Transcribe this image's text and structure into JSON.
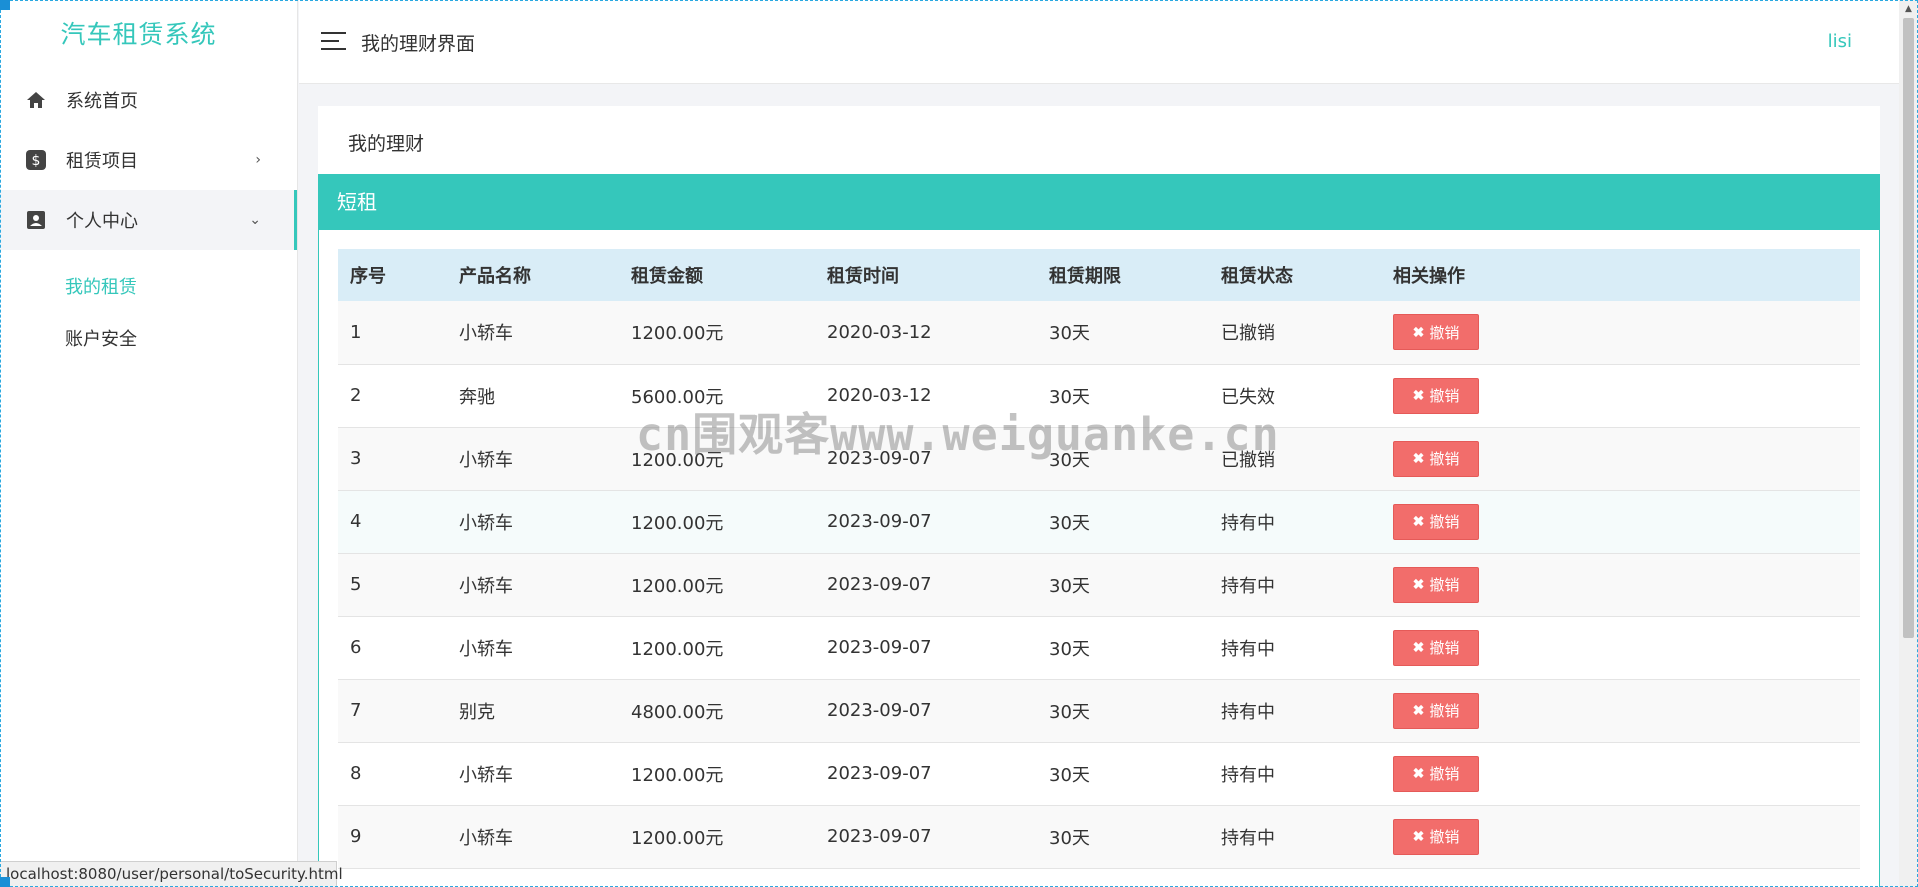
{
  "app": {
    "title": "汽车租赁系统"
  },
  "sidebar": {
    "items": [
      {
        "label": "系统首页",
        "icon": "home-icon"
      },
      {
        "label": "租赁项目",
        "icon": "dollar-icon",
        "arrow": "›"
      },
      {
        "label": "个人中心",
        "icon": "user-card-icon",
        "arrow": "⌄"
      }
    ],
    "subitems": [
      {
        "label": "我的租赁"
      },
      {
        "label": "账户安全"
      }
    ]
  },
  "header": {
    "title": "我的理财界面",
    "user": "lisi"
  },
  "main": {
    "heading": "我的理财",
    "panel_title": "短租",
    "columns": [
      "序号",
      "产品名称",
      "租赁金额",
      "租赁时间",
      "租赁期限",
      "租赁状态",
      "相关操作"
    ],
    "action_label": "撤销",
    "rows": [
      {
        "no": "1",
        "name": "小轿车",
        "amount": "1200.00元",
        "date": "2020-03-12",
        "term": "30天",
        "status": "已撤销"
      },
      {
        "no": "2",
        "name": "奔驰",
        "amount": "5600.00元",
        "date": "2020-03-12",
        "term": "30天",
        "status": "已失效"
      },
      {
        "no": "3",
        "name": "小轿车",
        "amount": "1200.00元",
        "date": "2023-09-07",
        "term": "30天",
        "status": "已撤销"
      },
      {
        "no": "4",
        "name": "小轿车",
        "amount": "1200.00元",
        "date": "2023-09-07",
        "term": "30天",
        "status": "持有中"
      },
      {
        "no": "5",
        "name": "小轿车",
        "amount": "1200.00元",
        "date": "2023-09-07",
        "term": "30天",
        "status": "持有中"
      },
      {
        "no": "6",
        "name": "小轿车",
        "amount": "1200.00元",
        "date": "2023-09-07",
        "term": "30天",
        "status": "持有中"
      },
      {
        "no": "7",
        "name": "别克",
        "amount": "4800.00元",
        "date": "2023-09-07",
        "term": "30天",
        "status": "持有中"
      },
      {
        "no": "8",
        "name": "小轿车",
        "amount": "1200.00元",
        "date": "2023-09-07",
        "term": "30天",
        "status": "持有中"
      },
      {
        "no": "9",
        "name": "小轿车",
        "amount": "1200.00元",
        "date": "2023-09-07",
        "term": "30天",
        "status": "持有中"
      }
    ]
  },
  "watermark": "cn围观客www.weiguanke.cn",
  "statusbar": {
    "url": "localhost:8080/user/personal/toSecurity.html"
  },
  "colors": {
    "accent": "#35c7bb",
    "danger": "#f26d6b",
    "table_head": "#d9edf7"
  }
}
